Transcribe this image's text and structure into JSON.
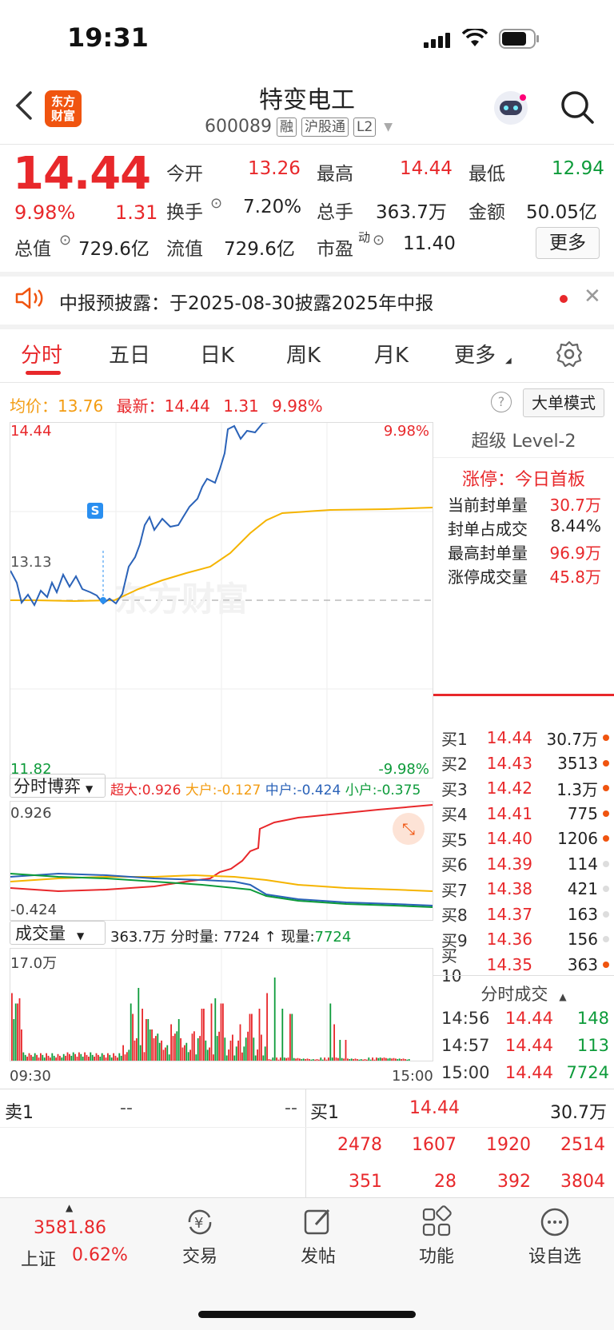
{
  "status_bar": {
    "time": "19:31"
  },
  "header": {
    "back_icon": "chevron-left-icon",
    "logo_text_1": "东方",
    "logo_text_2": "财富",
    "title": "特变电工",
    "code": "600089",
    "tags": [
      "融",
      "沪股通",
      "L2"
    ]
  },
  "quote": {
    "price": "14.44",
    "change_pct": "9.98%",
    "change": "1.31",
    "open_label": "今开",
    "open": "13.26",
    "high_label": "最高",
    "high": "14.44",
    "low_label": "最低",
    "low": "12.94",
    "turnover_label": "换手",
    "turnover": "7.20%",
    "volume_label": "总手",
    "volume": "363.7万",
    "amount_label": "金额",
    "amount": "50.05亿",
    "mktcap_label": "总值",
    "mktcap": "729.6亿",
    "float_label": "流值",
    "float": "729.6亿",
    "pe_label": "市盈",
    "pe_sup": "动",
    "pe": "11.40",
    "more_label": "更多"
  },
  "notice": {
    "text": "中报预披露：于2025-08-30披露2025年中报"
  },
  "tabs": [
    "分时",
    "五日",
    "日K",
    "周K",
    "月K",
    "更多"
  ],
  "chart_info": {
    "avg_label": "均价：",
    "avg": "13.76",
    "latest_label": "最新：",
    "latest": "14.44",
    "chg": "1.31",
    "pct": "9.98%",
    "mode_label": "大单模式"
  },
  "chart_axis": {
    "top_price": "14.44",
    "top_pct": "9.98%",
    "mid_price": "13.13",
    "bottom_price": "11.82",
    "bottom_pct": "-9.98%",
    "s_marker": "S",
    "watermark": "东方财富"
  },
  "level2": {
    "title": "超级 Level-2",
    "limit_label": "涨停：今日首板",
    "rows": [
      {
        "label": "当前封单量",
        "value": "30.7万"
      },
      {
        "label": "封单占成交",
        "value": "8.44%"
      },
      {
        "label": "最高封单量",
        "value": "96.9万"
      },
      {
        "label": "涨停成交量",
        "value": "45.8万"
      }
    ]
  },
  "order_book": [
    {
      "label": "买1",
      "price": "14.44",
      "vol": "30.7万",
      "dot": "#f0540f"
    },
    {
      "label": "买2",
      "price": "14.43",
      "vol": "3513",
      "dot": "#f0540f"
    },
    {
      "label": "买3",
      "price": "14.42",
      "vol": "1.3万",
      "dot": "#f0540f"
    },
    {
      "label": "买4",
      "price": "14.41",
      "vol": "775",
      "dot": "#f0540f"
    },
    {
      "label": "买5",
      "price": "14.40",
      "vol": "1206",
      "dot": "#f0540f"
    },
    {
      "label": "买6",
      "price": "14.39",
      "vol": "114",
      "dot": "#dddddd"
    },
    {
      "label": "买7",
      "price": "14.38",
      "vol": "421",
      "dot": "#dddddd"
    },
    {
      "label": "买8",
      "price": "14.37",
      "vol": "163",
      "dot": "#dddddd"
    },
    {
      "label": "买9",
      "price": "14.36",
      "vol": "156",
      "dot": "#dddddd"
    },
    {
      "label": "买10",
      "price": "14.35",
      "vol": "363",
      "dot": "#f0540f"
    }
  ],
  "ticks": {
    "title": "分时成交",
    "rows": [
      {
        "time": "14:56",
        "price": "14.44",
        "vol": "148"
      },
      {
        "time": "14:57",
        "price": "14.44",
        "vol": "113"
      },
      {
        "time": "15:00",
        "price": "14.44",
        "vol": "7724"
      }
    ]
  },
  "game": {
    "label": "分时博弈",
    "super_label": "超大:",
    "super": "0.926",
    "large_label": "大户:",
    "large": "-0.127",
    "mid_label": "中户:",
    "mid": "-0.424",
    "small_label": "小户:",
    "small": "-0.375",
    "top": "0.926",
    "bottom": "-0.424"
  },
  "volume": {
    "label": "成交量",
    "total": "363.7万",
    "minute_label": "分时量:",
    "minute": "7724",
    "now_label": "现量:",
    "now": "7724",
    "max": "17.0万",
    "start": "09:30",
    "end": "15:00"
  },
  "bottom_book": {
    "sell_label": "卖1",
    "sell_price": "--",
    "sell_vol": "--",
    "buy_label": "买1",
    "buy_price": "14.44",
    "buy_vol": "30.7万",
    "row1": [
      "2478",
      "1607",
      "1920",
      "2514"
    ],
    "row2": [
      "351",
      "28",
      "392",
      "3804"
    ]
  },
  "bottom_nav": {
    "index_value": "3581.86",
    "index_name": "上证",
    "index_pct": "0.62%",
    "items": [
      "交易",
      "发帖",
      "功能",
      "设自选"
    ]
  }
}
